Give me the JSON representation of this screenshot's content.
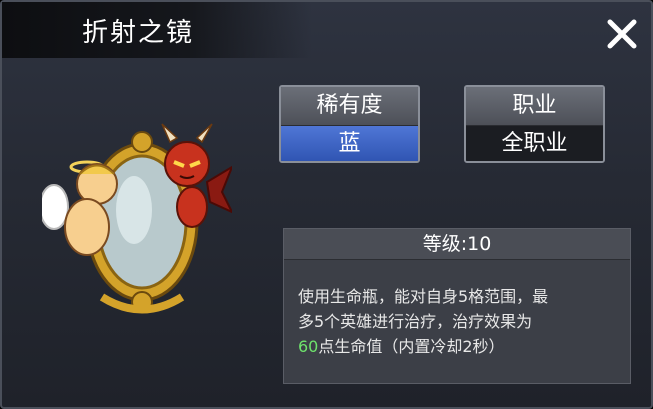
{
  "title": "折射之镜",
  "rarity": {
    "label": "稀有度",
    "value": "蓝"
  },
  "class": {
    "label": "职业",
    "value": "全职业"
  },
  "info": {
    "level_label": "等级:10",
    "desc_line1": "使用生命瓶，能对自身5格范围，最",
    "desc_line2": "多5个英雄进行治疗，治疗效果为",
    "desc_value": "60",
    "desc_line3_rest": "点生命值（内置冷却2秒）"
  },
  "colors": {
    "rarity_blue": "#3b5fc0",
    "highlight_green": "#6ee36c"
  }
}
